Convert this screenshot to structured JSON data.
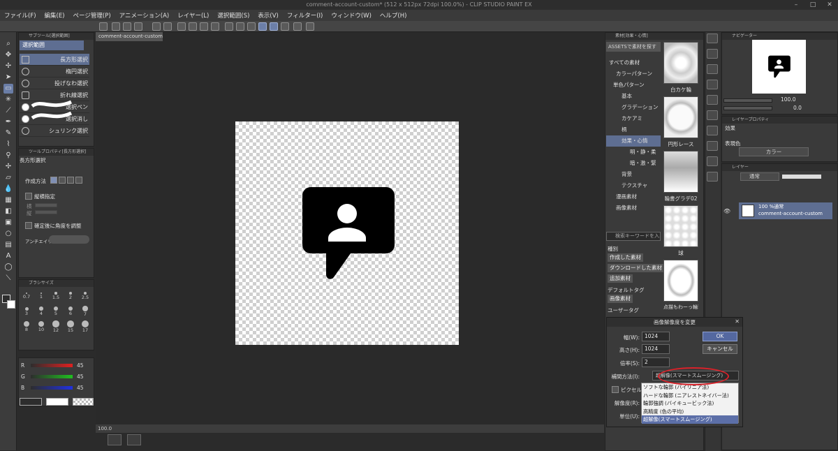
{
  "window": {
    "title": "comment-account-custom* (512 x 512px 72dpi 100.0%)  - CLIP STUDIO PAINT EX"
  },
  "menu": [
    "ファイル(F)",
    "編集(E)",
    "ページ管理(P)",
    "アニメーション(A)",
    "レイヤー(L)",
    "選択範囲(S)",
    "表示(V)",
    "フィルター(I)",
    "ウィンドウ(W)",
    "ヘルプ(H)"
  ],
  "subtool": {
    "panel_title": "サブツール[選択範囲]",
    "group_tab": "選択範囲",
    "items": [
      "長方形選択",
      "楕円選択",
      "投げなわ選択",
      "折れ線選択",
      "選択ペン",
      "選択消し",
      "シュリンク選択"
    ]
  },
  "tool_property": {
    "panel_title": "ツールプロパティ[長方形選択]",
    "tool_name": "長方形選択",
    "mode_label": "作成方法",
    "aspect_label": "縦横指定",
    "width_short": "横",
    "height_short": "縦",
    "angle_label": "確定後に角度を調整",
    "antialias_label": "アンチエイリアス"
  },
  "brush_size": {
    "panel_title": "ブラシサイズ",
    "sizes": [
      "0.7",
      "1",
      "1.5",
      "2",
      "2.5",
      "3",
      "4",
      "5",
      "6",
      "7",
      "8",
      "10",
      "12",
      "15",
      "17"
    ]
  },
  "color": {
    "r_label": "R",
    "g_label": "G",
    "b_label": "B",
    "r": "45",
    "g": "45",
    "b": "45",
    "fg": "#2d2d2d",
    "bg": "#ffffff"
  },
  "document": {
    "tab": "comment-account-custom*",
    "zoom": "100.0"
  },
  "material": {
    "panel_title": "素材[効果・心情]",
    "assets_button": "ASSETSで素材を探す",
    "categories": [
      "すべての素材",
      "カラーパターン",
      "単色パターン",
      "基本",
      "グラデーション",
      "カケアミ",
      "柄",
      "効果・心情",
      "明・静・柔",
      "暗・激・緊",
      "背景",
      "テクスチャ",
      "漫画素材",
      "画像素材"
    ],
    "tiles": [
      "白カケ輪",
      "円形レース",
      "輪書グラデ02",
      "球",
      "点描もわーっ輪郭"
    ],
    "search_placeholder": "検索キーワードを入...",
    "tags_header": "種別",
    "tags": [
      "作成した素材",
      "ダウンロードした素材",
      "追加素材"
    ],
    "default_tag_header": "デフォルトタグ",
    "default_tag": "画像素材",
    "user_tag": "ユーザータグ"
  },
  "dialog": {
    "title": "画像解像度を変更",
    "width_label": "幅(W):",
    "width_value": "1024",
    "height_label": "高さ(H):",
    "height_value": "1024",
    "scale_label": "倍率(S):",
    "scale_value": "2",
    "method_label": "補間方法(I):",
    "method_value": "超解像(スマートスムージング)",
    "pixel_label": "ピクセル数",
    "resolution_label": "解像度(R):",
    "unit_label": "単位(U):",
    "ok": "OK",
    "cancel": "キャンセル",
    "options": [
      "ソフトな輪郭 (バイリニア法)",
      "ハードな輪郭 (ニアレストネイバー法)",
      "輪郭強調 (バイキュービック法)",
      "高精度 (色の平均)",
      "超解像(スマートスムージング)"
    ]
  },
  "navigator": {
    "panel_title": "ナビゲーター",
    "zoom": "100.0",
    "angle": "0.0"
  },
  "layer_property": {
    "panel_title": "レイヤープロパティ",
    "effect_label": "効果",
    "expression_label": "表現色",
    "expression_value": "カラー"
  },
  "layer": {
    "panel_title": "レイヤー",
    "blend_mode": "通常",
    "opacity": "100 %通常",
    "name": "comment-account-custom"
  },
  "accent": "#5e6e92"
}
